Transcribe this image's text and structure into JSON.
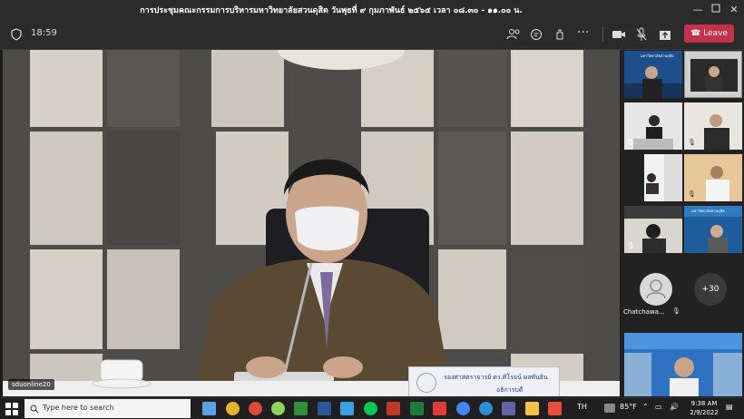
{
  "window": {
    "title": "การประชุมคณะกรรมการบริหารมหาวิทยาลัยสวนดุสิต วันพุธที่ ๙ กุมภาพันธ์ ๒๕๖๕ เวลา ๐๘.๓๐ - ๑๑.๐๐ น."
  },
  "meeting": {
    "timer": "18:59",
    "leave_label": "Leave"
  },
  "main_video": {
    "participant_label": "sduonline20",
    "nameplate_line1": "รองศาสตราจารย์ ดร.ศิโรจน์ ผลพันธิน",
    "nameplate_line2": "อธิการบดี"
  },
  "side_panel": {
    "participant_name": "Chatchawa...",
    "more_count": "+30",
    "thumb_texts": [
      "มหาวิทยาลัยสวนดุสิต",
      "มหาวิทยาลัยสวนดุสิต"
    ]
  },
  "taskbar": {
    "search_placeholder": "Type here to search",
    "language": "TH",
    "weather": "85°F",
    "time": "9:38 AM",
    "date": "2/9/2022"
  },
  "colors": {
    "leave": "#c4314b",
    "titlebar": "#2b2b2b",
    "taskbar": "#1f1f1f"
  }
}
